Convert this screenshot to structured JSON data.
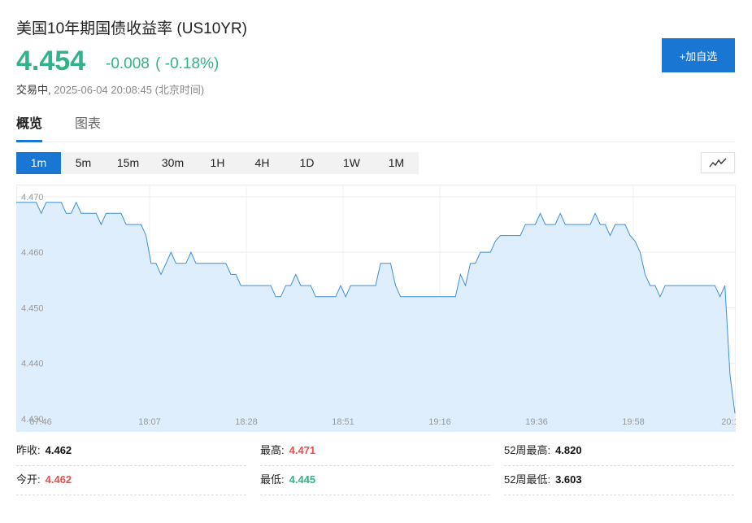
{
  "header": {
    "title": "美国10年期国债收益率 (US10YR)",
    "price": "4.454",
    "change": "-0.008",
    "change_pct": "( -0.18%)",
    "status": "交易中,",
    "timestamp": "2025-06-04 20:08:45 (北京时间)",
    "add_button": "+加自选"
  },
  "tabs": [
    {
      "label": "概览",
      "active": true
    },
    {
      "label": "图表",
      "active": false
    }
  ],
  "periods": [
    {
      "label": "1m",
      "active": true
    },
    {
      "label": "5m",
      "active": false
    },
    {
      "label": "15m",
      "active": false
    },
    {
      "label": "30m",
      "active": false
    },
    {
      "label": "1H",
      "active": false
    },
    {
      "label": "4H",
      "active": false
    },
    {
      "label": "1D",
      "active": false
    },
    {
      "label": "1W",
      "active": false
    },
    {
      "label": "1M",
      "active": false
    }
  ],
  "chart_type_icon": "line-chart-icon",
  "colors": {
    "accent": "#1976d2",
    "up": "#ef4b4b",
    "down": "#2fb38a",
    "area_fill": "#deeefc",
    "line": "#3d8fdb"
  },
  "chart_data": {
    "type": "area",
    "y_ticks": [
      "4.470",
      "4.460",
      "4.450",
      "4.440",
      "4.430"
    ],
    "ylim": [
      4.43,
      4.471
    ],
    "x_ticks": [
      "07:46",
      "18:07",
      "18:28",
      "18:51",
      "19:16",
      "19:36",
      "19:58",
      "20:1"
    ],
    "grid": true,
    "series": [
      {
        "values": [
          4.469,
          4.469,
          4.469,
          4.469,
          4.469,
          4.467,
          4.469,
          4.469,
          4.469,
          4.469,
          4.467,
          4.467,
          4.469,
          4.467,
          4.467,
          4.467,
          4.467,
          4.465,
          4.467,
          4.467,
          4.467,
          4.467,
          4.465,
          4.465,
          4.465,
          4.465,
          4.463,
          4.458,
          4.458,
          4.456,
          4.458,
          4.46,
          4.458,
          4.458,
          4.458,
          4.46,
          4.458,
          4.458,
          4.458,
          4.458,
          4.458,
          4.458,
          4.458,
          4.456,
          4.456,
          4.454,
          4.454,
          4.454,
          4.454,
          4.454,
          4.454,
          4.454,
          4.452,
          4.452,
          4.454,
          4.454,
          4.456,
          4.454,
          4.454,
          4.454,
          4.452,
          4.452,
          4.452,
          4.452,
          4.452,
          4.454,
          4.452,
          4.454,
          4.454,
          4.454,
          4.454,
          4.454,
          4.454,
          4.458,
          4.458,
          4.458,
          4.454,
          4.452,
          4.452,
          4.452,
          4.452,
          4.452,
          4.452,
          4.452,
          4.452,
          4.452,
          4.452,
          4.452,
          4.452,
          4.456,
          4.454,
          4.458,
          4.458,
          4.46,
          4.46,
          4.46,
          4.462,
          4.463,
          4.463,
          4.463,
          4.463,
          4.463,
          4.465,
          4.465,
          4.465,
          4.467,
          4.465,
          4.465,
          4.465,
          4.467,
          4.465,
          4.465,
          4.465,
          4.465,
          4.465,
          4.465,
          4.467,
          4.465,
          4.465,
          4.463,
          4.465,
          4.465,
          4.465,
          4.463,
          4.462,
          4.46,
          4.456,
          4.454,
          4.454,
          4.452,
          4.454,
          4.454,
          4.454,
          4.454,
          4.454,
          4.454,
          4.454,
          4.454,
          4.454,
          4.454,
          4.454,
          4.452,
          4.454,
          4.438,
          4.431
        ]
      }
    ]
  },
  "stats": [
    {
      "label": "昨收:",
      "value": "4.462",
      "color": "black"
    },
    {
      "label": "最高:",
      "value": "4.471",
      "color": "red"
    },
    {
      "label": "52周最高:",
      "value": "4.820",
      "color": "black"
    },
    {
      "label": "今开:",
      "value": "4.462",
      "color": "red"
    },
    {
      "label": "最低:",
      "value": "4.445",
      "color": "green"
    },
    {
      "label": "52周最低:",
      "value": "3.603",
      "color": "black"
    }
  ]
}
